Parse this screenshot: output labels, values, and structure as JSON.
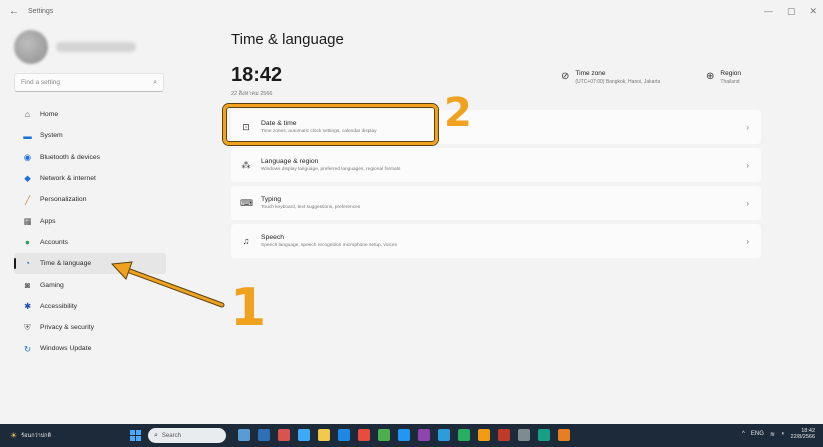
{
  "window": {
    "title": "Settings",
    "back_icon": "arrow-left-icon",
    "controls": [
      "—",
      "▢",
      "✕"
    ]
  },
  "sidebar": {
    "search_placeholder": "Find a setting",
    "items": [
      {
        "label": "Home",
        "icon": "home-icon",
        "glyph": "⌂",
        "color": "#444444"
      },
      {
        "label": "System",
        "icon": "system-icon",
        "glyph": "▬",
        "color": "#1e6fd9"
      },
      {
        "label": "Bluetooth & devices",
        "icon": "bluetooth-icon",
        "glyph": "◉",
        "color": "#1e6fd9"
      },
      {
        "label": "Network & internet",
        "icon": "network-icon",
        "glyph": "◆",
        "color": "#1e6fd9"
      },
      {
        "label": "Personalization",
        "icon": "brush-icon",
        "glyph": "╱",
        "color": "#c9862a"
      },
      {
        "label": "Apps",
        "icon": "apps-icon",
        "glyph": "▦",
        "color": "#555555"
      },
      {
        "label": "Accounts",
        "icon": "accounts-icon",
        "glyph": "●",
        "color": "#2e9e5e"
      },
      {
        "label": "Time & language",
        "icon": "globe-clock-icon",
        "glyph": "◔",
        "color": "#1e6fd9",
        "selected": true
      },
      {
        "label": "Gaming",
        "icon": "gaming-icon",
        "glyph": "◙",
        "color": "#666666"
      },
      {
        "label": "Accessibility",
        "icon": "accessibility-icon",
        "glyph": "✱",
        "color": "#1e4fa8"
      },
      {
        "label": "Privacy & security",
        "icon": "shield-icon",
        "glyph": "⛨",
        "color": "#777777"
      },
      {
        "label": "Windows Update",
        "icon": "update-icon",
        "glyph": "↻",
        "color": "#1e6fd9"
      }
    ]
  },
  "main": {
    "title": "Time & language",
    "clock": "18:42",
    "date": "22 สิงหาคม 2566",
    "timezone": {
      "label": "Time zone",
      "value": "(UTC+07:00) Bangkok, Hanoi, Jakarta",
      "icon": "timezone-icon"
    },
    "region": {
      "label": "Region",
      "value": "Thailand",
      "icon": "globe-icon"
    },
    "cards": [
      {
        "title": "Date & time",
        "desc": "Time zones, automatic clock settings, calendar display",
        "icon": "calendar-clock-icon",
        "glyph": "⊡"
      },
      {
        "title": "Language & region",
        "desc": "Windows display language, preferred languages, regional formats",
        "icon": "language-icon",
        "glyph": "⁂"
      },
      {
        "title": "Typing",
        "desc": "Touch keyboard, text suggestions, preferences",
        "icon": "keyboard-icon",
        "glyph": "⌨"
      },
      {
        "title": "Speech",
        "desc": "Speech language, speech recognition microphone setup, voices",
        "icon": "speech-icon",
        "glyph": "♫"
      }
    ],
    "chevron": "›"
  },
  "annotations": {
    "step1": "1",
    "step2": "2",
    "accent_color": "#f0a21f"
  },
  "taskbar": {
    "weather_text": "ร้อนกว่าปกติ",
    "search_placeholder": "Search",
    "tray_lang": "ENG",
    "tray_time": "18:42",
    "tray_date": "22/8/2566",
    "app_colors": [
      "#5b9bd5",
      "#2f6fb5",
      "#d9534f",
      "#3fa9f5",
      "#f2c94c",
      "#1e88e5",
      "#e74c3c",
      "#4caf50",
      "#2196f3",
      "#8e44ad",
      "#2d9cdb",
      "#27ae60",
      "#f39c12",
      "#c0392b",
      "#7f8c8d",
      "#16a085",
      "#e67e22"
    ]
  }
}
